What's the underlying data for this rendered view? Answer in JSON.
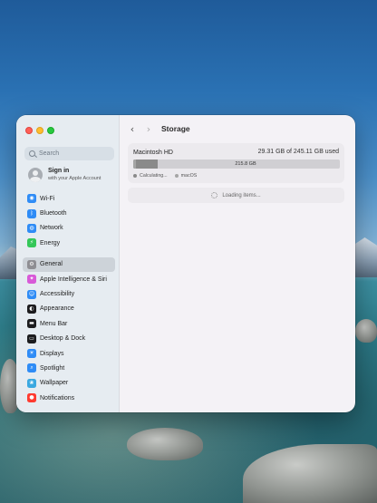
{
  "sidebar": {
    "search_placeholder": "Search",
    "account": {
      "name": "Sign in",
      "subtitle": "with your Apple Account"
    },
    "items": [
      {
        "label": "Wi-Fi",
        "icon": "wifi-icon",
        "color": "#2f8cf6",
        "glyph": "◉",
        "selected": false
      },
      {
        "label": "Bluetooth",
        "icon": "bluetooth-icon",
        "color": "#2f8cf6",
        "glyph": "ᛒ",
        "selected": false
      },
      {
        "label": "Network",
        "icon": "globe-icon",
        "color": "#2f8cf6",
        "glyph": "◍",
        "selected": false
      },
      {
        "label": "Energy",
        "icon": "battery-icon",
        "color": "#34c759",
        "glyph": "⚡",
        "selected": false
      },
      {
        "label": "General",
        "icon": "gear-icon",
        "color": "#8e8e93",
        "glyph": "⚙",
        "selected": true
      },
      {
        "label": "Apple Intelligence & Siri",
        "icon": "siri-icon",
        "color": "#d85ad8",
        "glyph": "✦",
        "selected": false
      },
      {
        "label": "Accessibility",
        "icon": "accessibility-icon",
        "color": "#2f8cf6",
        "glyph": "☺",
        "selected": false
      },
      {
        "label": "Appearance",
        "icon": "appearance-icon",
        "color": "#1c1c1e",
        "glyph": "◐",
        "selected": false
      },
      {
        "label": "Menu Bar",
        "icon": "menubar-icon",
        "color": "#1c1c1e",
        "glyph": "▬",
        "selected": false
      },
      {
        "label": "Desktop & Dock",
        "icon": "dock-icon",
        "color": "#1c1c1e",
        "glyph": "▭",
        "selected": false
      },
      {
        "label": "Displays",
        "icon": "display-icon",
        "color": "#2f8cf6",
        "glyph": "☀",
        "selected": false
      },
      {
        "label": "Spotlight",
        "icon": "spotlight-icon",
        "color": "#2f8cf6",
        "glyph": "⌕",
        "selected": false
      },
      {
        "label": "Wallpaper",
        "icon": "wallpaper-icon",
        "color": "#3aa8e0",
        "glyph": "❀",
        "selected": false
      },
      {
        "label": "Notifications",
        "icon": "bell-icon",
        "color": "#ff3b30",
        "glyph": "●",
        "selected": false
      }
    ]
  },
  "toolbar": {
    "back_glyph": "‹",
    "forward_glyph": "›",
    "title": "Storage"
  },
  "storage": {
    "disk_name": "Macintosh HD",
    "usage_text": "29.31 GB of 245.11 GB used",
    "used_fraction": 0.12,
    "free_label": "215.8 GB",
    "legend": [
      {
        "label": "Calculating...",
        "color": "#8a8a8a"
      },
      {
        "label": "macOS",
        "color": "#a5a5a5"
      }
    ]
  },
  "loading_text": "Loading items..."
}
